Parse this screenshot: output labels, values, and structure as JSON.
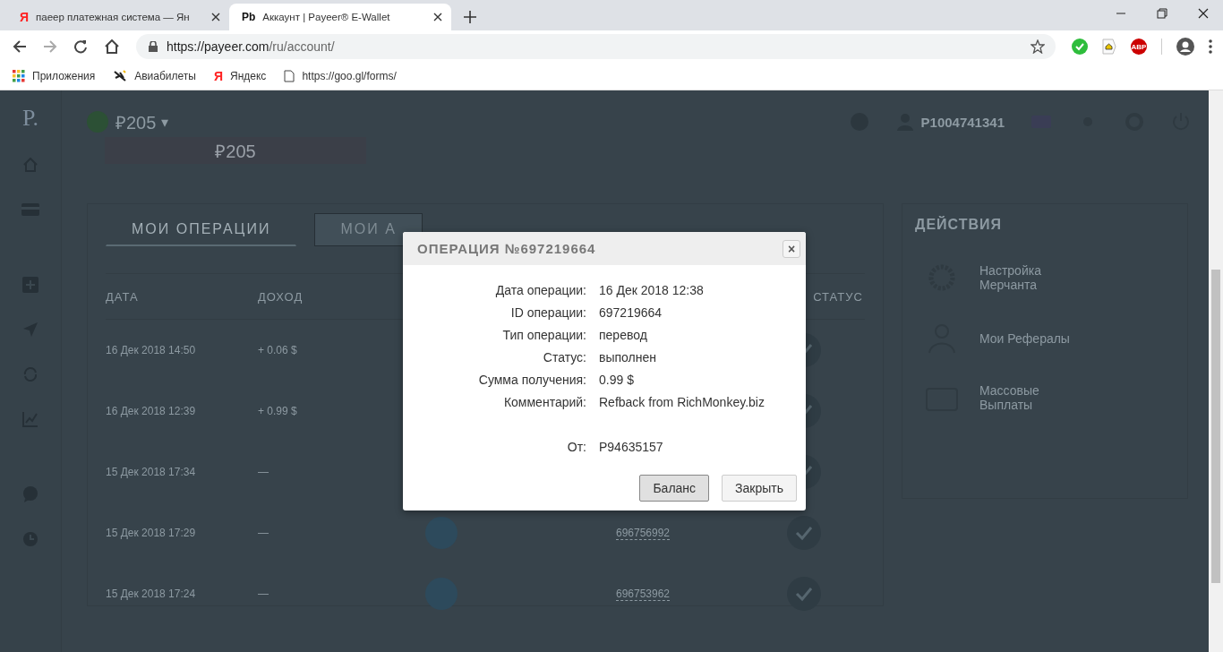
{
  "browser": {
    "tabs": [
      {
        "title": "паеер платежная система — Ян",
        "favicon": "Я",
        "selected": false
      },
      {
        "title": "Аккаунт | Payeer® E-Wallet",
        "favicon": "Pb",
        "selected": true
      }
    ],
    "url_host": "https://payeer.com",
    "url_path": "/ru/account/",
    "bookmarks": [
      {
        "kind": "apps",
        "label": "Приложения"
      },
      {
        "kind": "plane",
        "label": "Авиабилеты"
      },
      {
        "kind": "yandex",
        "label": "Яндекс",
        "glyph": "Я"
      },
      {
        "kind": "page",
        "label": "https://goo.gl/forms/"
      }
    ],
    "extension_badge": "ABP"
  },
  "page": {
    "logo": "P.",
    "balance_header": "₽205",
    "balance_caret": "▾",
    "balance_value": "₽205",
    "account": "P1004741341",
    "tabs": [
      {
        "label": "МОИ ОПЕРАЦИИ",
        "selected": true
      },
      {
        "label": "МОИ А",
        "selected": false
      }
    ],
    "columns": [
      "ДАТА",
      "ДОХОД",
      "СТАТУС"
    ],
    "rows": [
      {
        "date": "16 Дек 2018 14:50",
        "income": "+ 0.06 $"
      },
      {
        "date": "16 Дек 2018 12:39",
        "income": "+ 0.99 $"
      },
      {
        "date": "15 Дек 2018 17:34",
        "income": "—"
      },
      {
        "date": "15 Дек 2018 17:29",
        "income": "—",
        "id": "696756992"
      },
      {
        "date": "15 Дек 2018 17:24",
        "income": "—",
        "id": "696753962"
      }
    ],
    "actions_title": "ДЕЙСТВИЯ",
    "actions": [
      {
        "kind": "gear",
        "label": "Настройка Мерчанта"
      },
      {
        "kind": "people",
        "label": "Мои Рефералы"
      },
      {
        "kind": "wallet",
        "label": "Массовые Выплаты"
      }
    ]
  },
  "dialog": {
    "title": "ОПЕРАЦИЯ №697219664",
    "close": "×",
    "fields": [
      {
        "label": "Дата операции:",
        "value": "16 Дек 2018 12:38"
      },
      {
        "label": "ID операции:",
        "value": "697219664"
      },
      {
        "label": "Тип операции:",
        "value": "перевод"
      },
      {
        "label": "Статус:",
        "value": "выполнен"
      },
      {
        "label": "Сумма получения:",
        "value": "0.99 $"
      },
      {
        "label": "Комментарий:",
        "value": "Refback from RichMonkey.biz"
      },
      {
        "label": "От:",
        "value": "P94635157"
      }
    ],
    "buttons": [
      {
        "label": "Баланс",
        "primary": true
      },
      {
        "label": "Закрыть",
        "primary": false
      }
    ]
  }
}
